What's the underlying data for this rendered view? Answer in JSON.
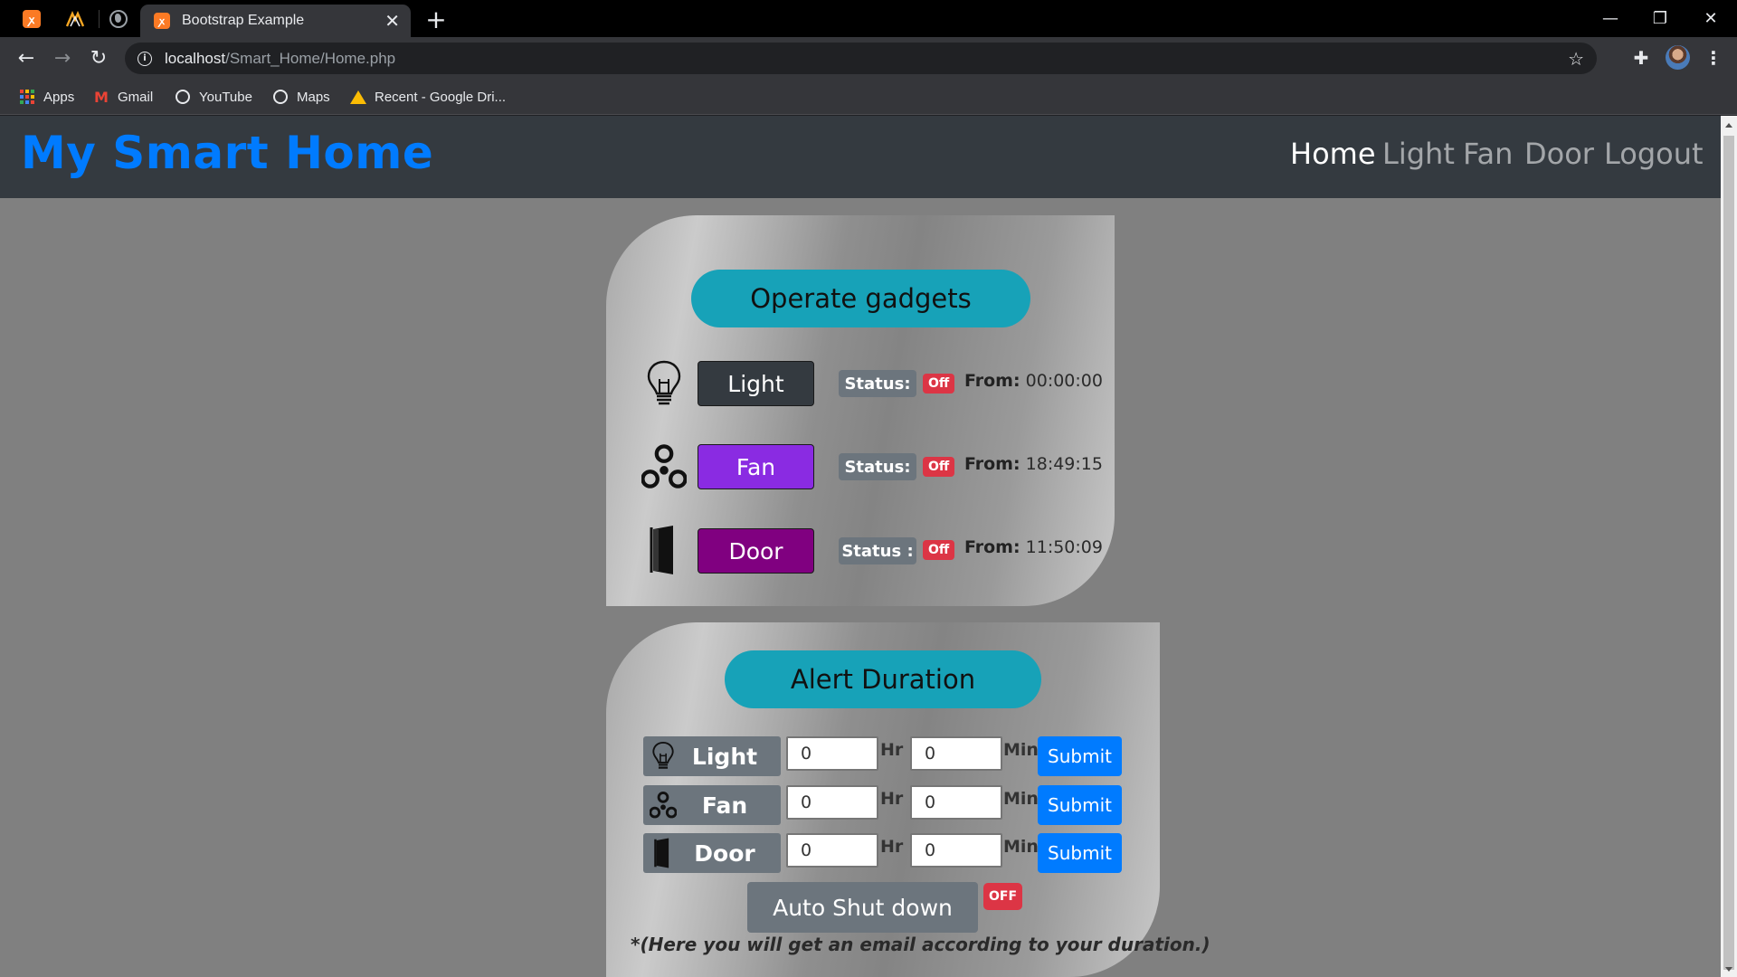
{
  "browser": {
    "active_tab_title": "Bootstrap Example",
    "url_host": "localhost",
    "url_path": "/Smart_Home/Home.php",
    "bookmarks": [
      {
        "label": "Apps",
        "icon": "apps-grid-icon"
      },
      {
        "label": "Gmail",
        "icon": "gmail-icon"
      },
      {
        "label": "YouTube",
        "icon": "globe-icon"
      },
      {
        "label": "Maps",
        "icon": "globe-icon"
      },
      {
        "label": "Recent - Google Dri...",
        "icon": "google-drive-icon"
      }
    ]
  },
  "navbar": {
    "brand": "My Smart Home",
    "links": [
      {
        "label": "Home",
        "active": true
      },
      {
        "label": "Light",
        "active": false
      },
      {
        "label": "Fan",
        "active": false
      },
      {
        "label": "Door",
        "active": false
      },
      {
        "label": "Logout",
        "active": false
      }
    ],
    "brand_color": "#007bff",
    "bg_color": "#343a40"
  },
  "operate": {
    "title": "Operate gadgets",
    "gadgets": [
      {
        "name": "Light",
        "icon": "lightbulb-icon",
        "button_color": "#343a40",
        "status_label": "Status:",
        "status": "Off",
        "from_label": "From:",
        "from_time": "00:00:00"
      },
      {
        "name": "Fan",
        "icon": "fan-icon",
        "button_color": "#8a2be2",
        "status_label": "Status:",
        "status": "Off",
        "from_label": "From:",
        "from_time": "18:49:15"
      },
      {
        "name": "Door",
        "icon": "door-icon",
        "button_color": "#800080",
        "status_label": "Status :",
        "status": "Off",
        "from_label": "From:",
        "from_time": "11:50:09"
      }
    ]
  },
  "alert": {
    "title": "Alert Duration",
    "rows": [
      {
        "label": "Light",
        "icon": "lightbulb-icon",
        "hr": "0",
        "min": "0"
      },
      {
        "label": "Fan",
        "icon": "fan-icon",
        "hr": "0",
        "min": "0"
      },
      {
        "label": "Door",
        "icon": "door-icon",
        "hr": "0",
        "min": "0"
      }
    ],
    "hr_unit": "Hr",
    "min_unit": "Min",
    "submit_label": "Submit",
    "auto_shutdown_label": "Auto Shut down",
    "auto_shutdown_state": "OFF",
    "note": "*(Here you will get an email according to your duration.)"
  }
}
